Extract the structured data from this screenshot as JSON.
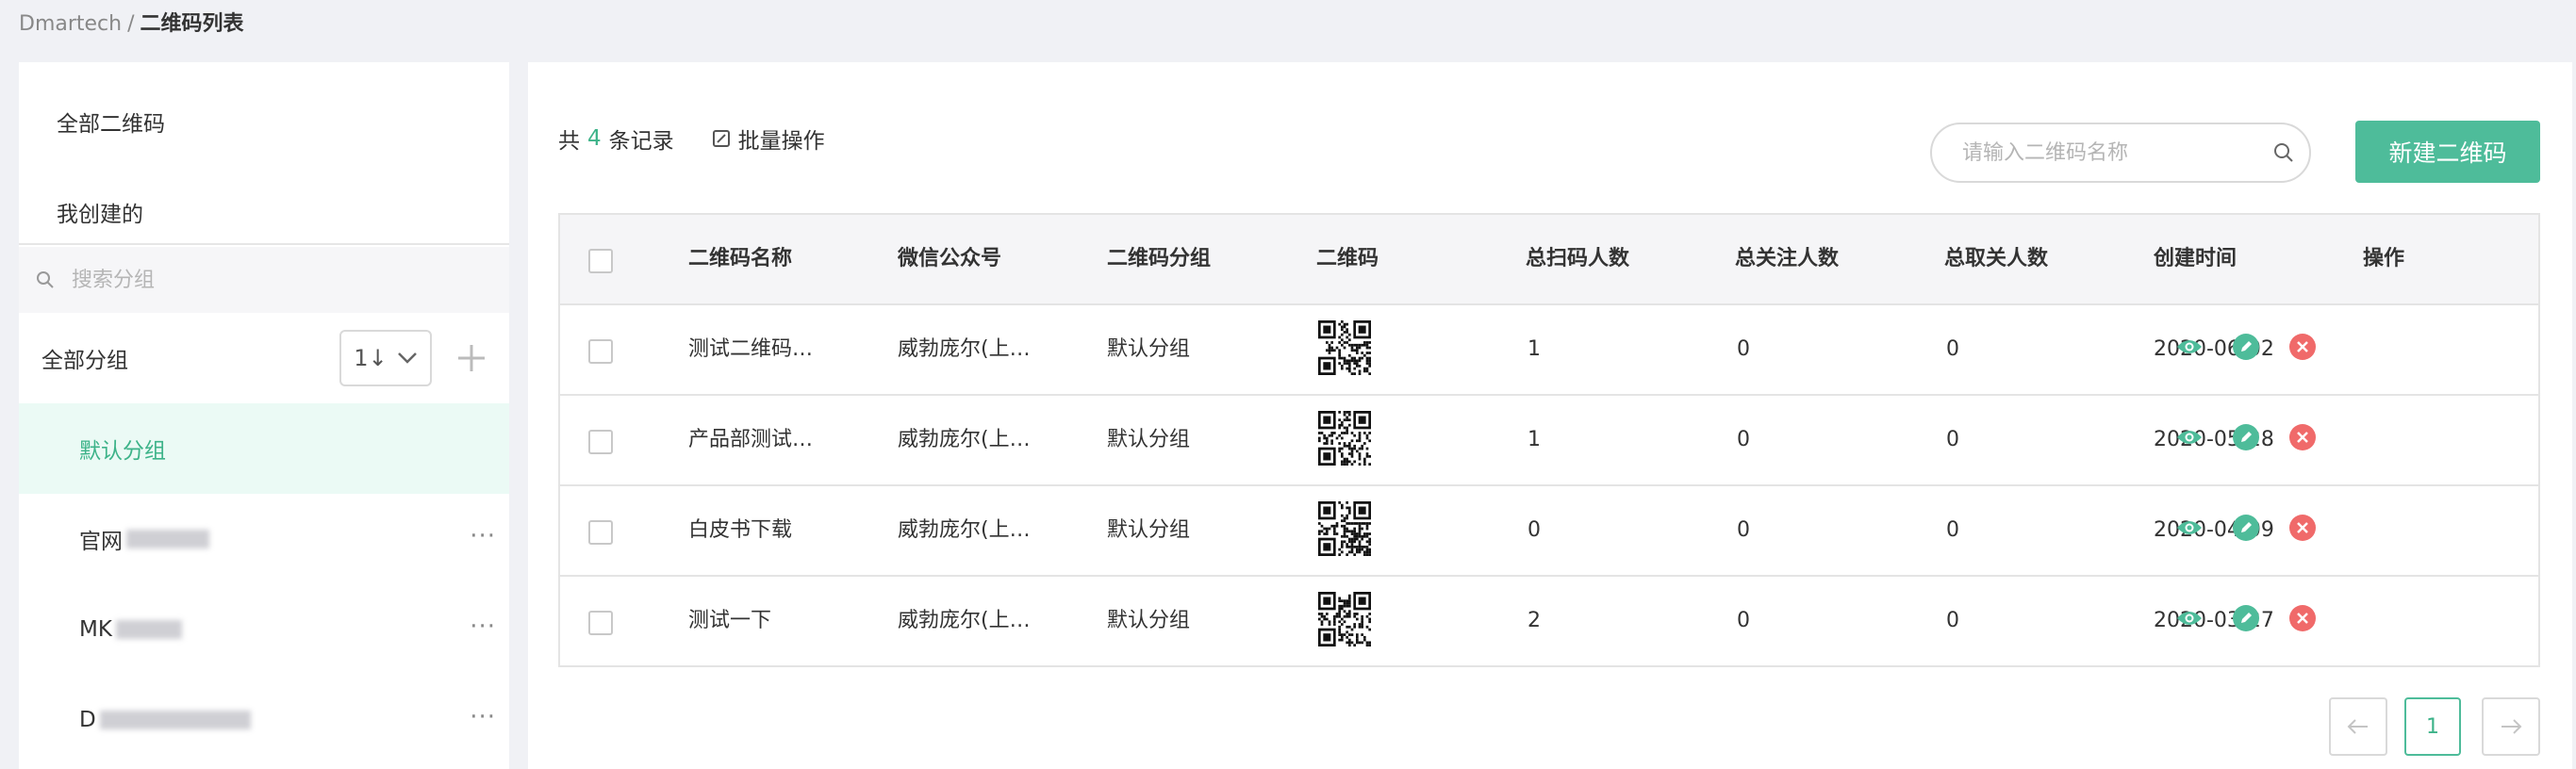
{
  "breadcrumb": {
    "root": "Dmartech",
    "separator": "/",
    "current": "二维码列表"
  },
  "sidebar": {
    "all_qr": "全部二维码",
    "mine": "我创建的",
    "search_placeholder": "搜索分组",
    "group_header": "全部分组",
    "sort_label": "1↓",
    "groups": [
      {
        "label": "默认分组",
        "active": true
      },
      {
        "label": "官网",
        "blurred": true
      },
      {
        "label": "MK",
        "blurred": true
      },
      {
        "label": "D",
        "blurred": true
      }
    ],
    "more": "···"
  },
  "main": {
    "summary": {
      "prefix": "共",
      "count": "4",
      "suffix": "条记录"
    },
    "batch_label": "批量操作",
    "search_placeholder": "请输入二维码名称",
    "new_button": "新建二维码",
    "table": {
      "columns": [
        "二维码名称",
        "微信公众号",
        "二维码分组",
        "二维码",
        "总扫码人数",
        "总关注人数",
        "总取关人数",
        "创建时间",
        "操作"
      ],
      "rows": [
        {
          "name": "测试二维码…",
          "account": "威勃庞尔(上…",
          "group": "默认分组",
          "scans": "1",
          "follows": "0",
          "unfollows": "0",
          "created": "2020-06-02"
        },
        {
          "name": "产品部测试…",
          "account": "威勃庞尔(上…",
          "group": "默认分组",
          "scans": "1",
          "follows": "0",
          "unfollows": "0",
          "created": "2020-05-28"
        },
        {
          "name": "白皮书下载",
          "account": "威勃庞尔(上…",
          "group": "默认分组",
          "scans": "0",
          "follows": "0",
          "unfollows": "0",
          "created": "2020-04-09"
        },
        {
          "name": "测试一下",
          "account": "威勃庞尔(上…",
          "group": "默认分组",
          "scans": "2",
          "follows": "0",
          "unfollows": "0",
          "created": "2020-03-27"
        }
      ]
    },
    "pagination": {
      "current": "1"
    }
  },
  "colors": {
    "accent": "#4ebc9a",
    "accent_text": "#3db389",
    "danger": "#f06a6a",
    "active_bg": "#ebfaf5"
  }
}
